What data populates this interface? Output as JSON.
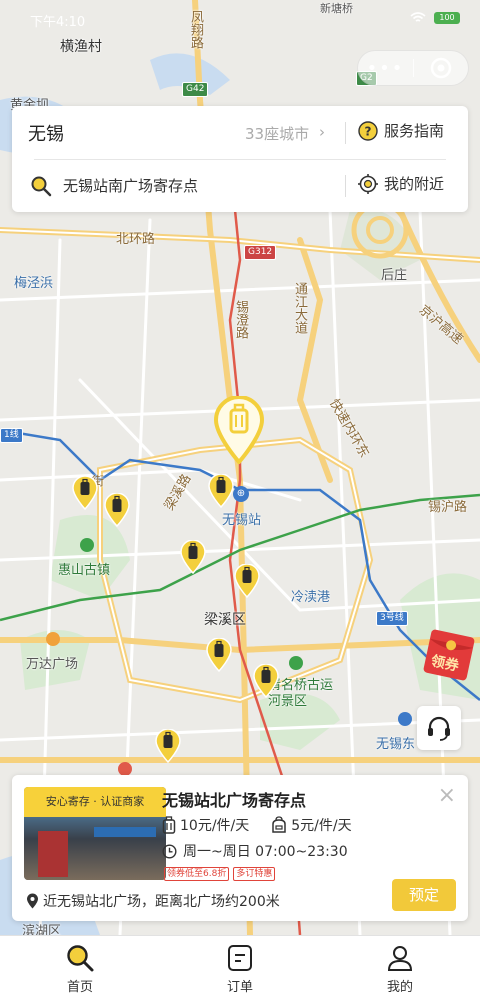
{
  "status_bar": {
    "time": "下午4:10",
    "battery": "100"
  },
  "search_card": {
    "city": "无锡",
    "city_count": "33座城市",
    "chevron": "›",
    "guide_label": "服务指南",
    "search_value": "无锡站南广场寄存点",
    "nearby_label": "我的附近"
  },
  "map": {
    "labels": {
      "hengyu": "横渔村",
      "fengxiang": "凤翔路",
      "huangjin": "黄金坝",
      "beihuan": "北环路",
      "meijingbang": "梅泾浜",
      "xicheng": "锡澄路",
      "tongjiang": "通江大道",
      "houzhuang": "后庄",
      "huning_gs": "京沪高速",
      "kuaisu": "快速内环东",
      "xihu": "锡沪路",
      "station": "无锡站",
      "huishan": "惠山古镇",
      "liangxi": "梁溪区",
      "lingdu": "冷渎港",
      "wanda": "万达广场",
      "qingming": "清名桥古运河景区",
      "wuxi_east": "无锡东",
      "binhu": "滨湖区",
      "xinan": "新塘桥",
      "line3": "3号线",
      "line1": "1线",
      "jie": "街",
      "liangqi": "梁溪路"
    },
    "shields": {
      "g42": "G42",
      "g2": "G2",
      "g312": "G312"
    }
  },
  "coupon": {
    "label": "领券"
  },
  "store": {
    "badge": "安心寄存 · 认证商家",
    "close": "×",
    "name": "无锡站北广场寄存点",
    "price_large": "10元/件/天",
    "price_small": "5元/件/天",
    "hours": "周一~周日 07:00~23:30",
    "tags": [
      "领券低至6.8折",
      "多订特惠"
    ],
    "address": "近无锡站北广场，距离北广场约200米",
    "book_label": "预定"
  },
  "tabs": [
    {
      "label": "首页",
      "icon": "search-icon"
    },
    {
      "label": "订单",
      "icon": "order-icon"
    },
    {
      "label": "我的",
      "icon": "user-icon"
    }
  ],
  "colors": {
    "accent": "#f2c93a",
    "pin": "#f3cf3c",
    "metro_red": "#e05a4a",
    "metro_blue": "#3c79c8",
    "metro_green": "#3da24a"
  }
}
